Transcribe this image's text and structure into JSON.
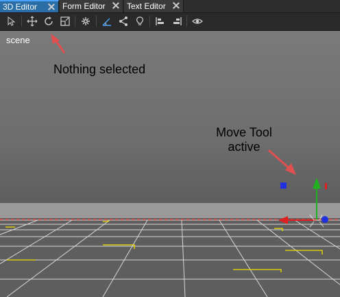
{
  "tabs": [
    {
      "label": "3D Editor",
      "active": true
    },
    {
      "label": "Form Editor",
      "active": false
    },
    {
      "label": "Text Editor",
      "active": false
    }
  ],
  "toolbar": {
    "icons": [
      "select-arrow-icon",
      "move-icon",
      "rotate-icon",
      "scale-icon",
      "snap-icon",
      "angle-icon",
      "share-icon",
      "light-bulb-icon",
      "align-left-icon",
      "align-right-icon",
      "visibility-eye-icon"
    ]
  },
  "viewport": {
    "label": "scene"
  },
  "annotations": {
    "nothing_selected": "Nothing selected",
    "move_tool_line1": "Move Tool",
    "move_tool_line2": "active"
  },
  "colors": {
    "accent_tab": "#2b6ea5",
    "arrow": "#e05050"
  }
}
